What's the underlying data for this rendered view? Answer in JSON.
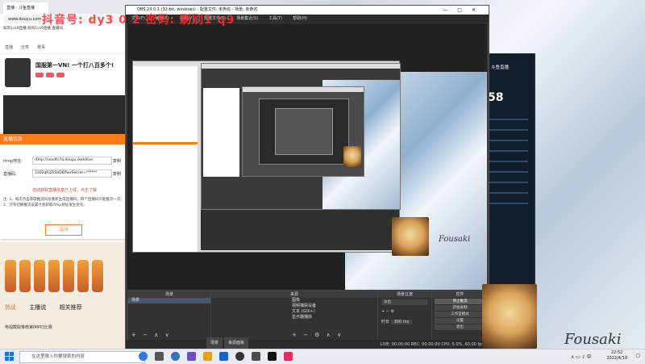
{
  "watermark": "抖音号: dy3 0 2   密码: 刷刷1 q9",
  "browser": {
    "tab_label": "直播 - 斗鱼直播",
    "address": "www.douyu.com",
    "bookmarks": "斜风1vs9直播   斜风1vs9直播   直播间...",
    "nav": [
      "直播",
      "分类",
      "赛事",
      "直播"
    ],
    "streamer_title": "国服第一VN! 一个打八百多个!",
    "popup": {
      "title": "直播信息",
      "rtmp_label": "rtmp地址:",
      "rtmp_value": "rtmp://sendtc7a.douyu.com/live",
      "code_label": "直播码:",
      "code_value": "3302q93ZiSVDOTwxSecret=******",
      "copy": "复制",
      "link_text": "自动获取直播信息已上线，点击了解",
      "notes": "注: 1、每次点击获取推流码会重新生成直播码，每个直播码只能推流一次。2、只有切换推流设置才会获取rtmp地址发生变化。",
      "ok": "关闭"
    },
    "lower_tabs": [
      "热议",
      "主播说",
      "相关推荐"
    ],
    "lower_strip": "电视截取推荐第IMP打比赛"
  },
  "obs": {
    "title": "OBS 24.0.1 (32-bit, windows) - 配置文件: 未命名 - 场景: 未命名",
    "menu": [
      "文件(F)",
      "编辑(E)",
      "视图(V)",
      "配置文件(P)",
      "场景集合(S)",
      "工具(T)",
      "帮助(H)"
    ],
    "docks": {
      "scenes": {
        "title": "场景",
        "items": [
          "场景"
        ]
      },
      "sources": {
        "title": "来源",
        "items": [
          "图像",
          "视频捕获设备",
          "文本 (GDI+)",
          "显示器捕获"
        ]
      },
      "mixer": {
        "title": "混音器"
      },
      "transitions": {
        "title": "场景过渡",
        "type": "淡出",
        "duration_label": "时长",
        "duration": "300 ms"
      },
      "controls": {
        "title": "控件",
        "buttons": [
          "停止推流",
          "开始录制",
          "工作室模式",
          "设置",
          "退出"
        ]
      }
    },
    "tabs": [
      "场景",
      "来源面板"
    ],
    "status": "LIVE: 00:00:00   REC: 00:00:00   CPU: 5.0%, 60.00 fps"
  },
  "right_window": {
    "label": "斗鱼直播",
    "number": "58"
  },
  "signature": "Fousaki",
  "taskbar": {
    "search_placeholder": "在这里输入你要搜索的内容",
    "time": "22:52",
    "date": "2022/4/10"
  }
}
